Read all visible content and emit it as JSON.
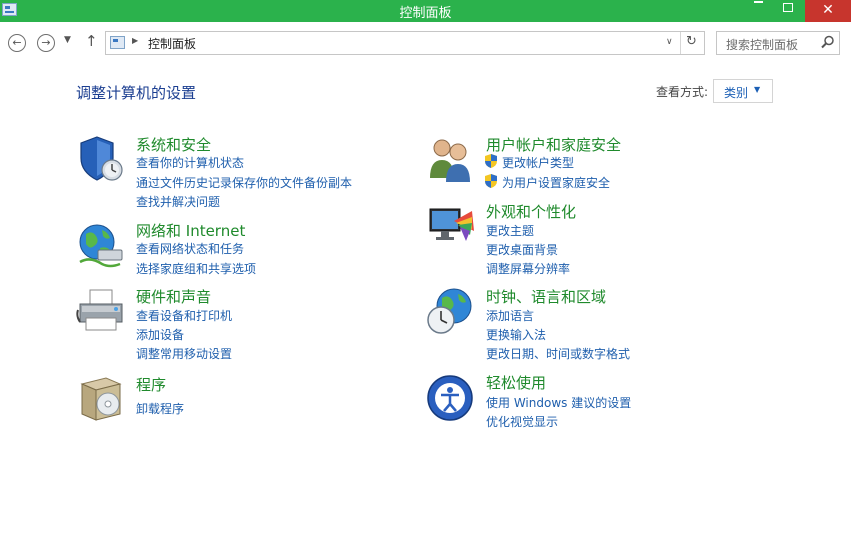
{
  "window": {
    "title": "控制面板"
  },
  "address": {
    "path": "控制面板"
  },
  "search": {
    "placeholder": "搜索控制面板"
  },
  "page": {
    "title": "调整计算机的设置",
    "view_label": "查看方式:",
    "view_value": "类别"
  },
  "categories": {
    "system": {
      "title": "系统和安全",
      "icon": "shield-icon",
      "links": [
        "查看你的计算机状态",
        "通过文件历史记录保存你的文件备份副本",
        "查找并解决问题"
      ]
    },
    "network": {
      "title": "网络和 Internet",
      "icon": "network-globe-icon",
      "links": [
        "查看网络状态和任务",
        "选择家庭组和共享选项"
      ]
    },
    "hardware": {
      "title": "硬件和声音",
      "icon": "printer-icon",
      "links": [
        "查看设备和打印机",
        "添加设备",
        "调整常用移动设置"
      ]
    },
    "programs": {
      "title": "程序",
      "icon": "programs-box-icon",
      "links": [
        "卸载程序"
      ]
    },
    "accounts": {
      "title": "用户帐户和家庭安全",
      "icon": "users-icon",
      "links": [
        "更改帐户类型",
        "为用户设置家庭安全"
      ]
    },
    "appearance": {
      "title": "外观和个性化",
      "icon": "monitor-palette-icon",
      "links": [
        "更改主题",
        "更改桌面背景",
        "调整屏幕分辨率"
      ]
    },
    "clock": {
      "title": "时钟、语言和区域",
      "icon": "clock-globe-icon",
      "links": [
        "添加语言",
        "更换输入法",
        "更改日期、时间或数字格式"
      ]
    },
    "ease": {
      "title": "轻松使用",
      "icon": "ease-of-access-icon",
      "links": [
        "使用 Windows 建议的设置",
        "优化视觉显示"
      ]
    }
  },
  "colors": {
    "titlebar": "#2bb24c",
    "category_title": "#1f8a2c",
    "link": "#1f5fad",
    "page_title": "#1b3e91"
  }
}
